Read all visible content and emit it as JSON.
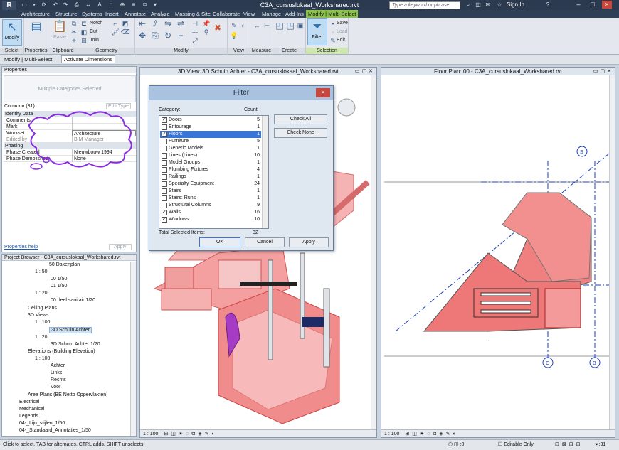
{
  "window": {
    "title": "C3A_cursuslokaal_Workshared.rvt",
    "search_placeholder": "Type a keyword or phrase",
    "signin": "Sign In"
  },
  "ribbon_tabs": [
    "Architecture",
    "Structure",
    "Systems",
    "Insert",
    "Annotate",
    "Analyze",
    "Massing & Site",
    "Collaborate",
    "View",
    "Manage",
    "Add-Ins",
    "Modify | Multi-Select"
  ],
  "ribbon": {
    "modify": "Modify",
    "select_label": "Select",
    "properties_label": "Properties",
    "clipboard": {
      "label": "Clipboard",
      "paste": "Paste"
    },
    "geometry": {
      "label": "Geometry",
      "notch": "Notch",
      "cut": "Cut",
      "join": "Join"
    },
    "modify_group": "Modify",
    "view_group": "View",
    "measure_group": "Measure",
    "create_group": "Create",
    "selection": {
      "label": "Selection",
      "filter": "Filter",
      "save": "Save",
      "load": "Load",
      "edit": "Edit"
    }
  },
  "context_bar": {
    "tab1": "Modify | Multi-Select",
    "tab2": "Activate Dimensions"
  },
  "properties": {
    "title": "Properties",
    "type_selector": "Multiple Categories Selected",
    "filter_count": "Common (31)",
    "edit_type": "Edit Type",
    "sections": {
      "identity": "Identity Data",
      "phasing": "Phasing"
    },
    "rows": [
      {
        "key": "Comments",
        "value": ""
      },
      {
        "key": "Mark",
        "value": ""
      },
      {
        "key": "Workset",
        "value": "Architecture"
      },
      {
        "key": "Edited by",
        "value": "BIM Manager"
      },
      {
        "key": "Phase Created",
        "value": "Nieuwbouw 1994"
      },
      {
        "key": "Phase Demolished",
        "value": "None"
      }
    ],
    "help": "Properties help",
    "apply": "Apply"
  },
  "browser": {
    "title": "Project Browser - C3A_cursuslokaal_Workshared.rvt",
    "items": [
      "50 Dakenplan",
      "1 : 50",
      "00 1/50",
      "01 1/50",
      "1 : 20",
      "00 deel sanitair 1/20",
      "Ceiling Plans",
      "3D Views",
      "1 : 100",
      "3D Schuin Achter",
      "1 : 20",
      "3D Schuin Achter 1/20",
      "Elevations (Building Elevation)",
      "1 : 100",
      "Achter",
      "Links",
      "Rechts",
      "Voor",
      "Area Plans (BE Netto Oppervlakten)",
      "Electrical",
      "Mechanical",
      "Legends",
      "04-_Lijn_stijlen_1/50",
      "04-_Standaard_Annotaties_1/50"
    ]
  },
  "view3d": {
    "title": "3D View: 3D Schuin Achter - C3A_cursuslokaal_Workshared.rvt",
    "scale": "1 : 100"
  },
  "plan": {
    "title": "Floor Plan: 00 - C3A_cursuslokaal_Workshared.rvt",
    "scale": "1 : 100",
    "grids": [
      "S",
      "C",
      "B"
    ]
  },
  "filter_dialog": {
    "title": "Filter",
    "category_label": "Category:",
    "count_label": "Count:",
    "categories": [
      {
        "name": "Doors",
        "count": "5",
        "checked": true,
        "selected": false
      },
      {
        "name": "Entourage",
        "count": "1",
        "checked": false,
        "selected": false
      },
      {
        "name": "Floors",
        "count": "1",
        "checked": true,
        "selected": true
      },
      {
        "name": "Furniture",
        "count": "5",
        "checked": false,
        "selected": false
      },
      {
        "name": "Generic Models",
        "count": "1",
        "checked": false,
        "selected": false
      },
      {
        "name": "Lines (Lines)",
        "count": "10",
        "checked": false,
        "selected": false
      },
      {
        "name": "Model Groups",
        "count": "1",
        "checked": false,
        "selected": false
      },
      {
        "name": "Plumbing Fixtures",
        "count": "4",
        "checked": false,
        "selected": false
      },
      {
        "name": "Railings",
        "count": "1",
        "checked": false,
        "selected": false
      },
      {
        "name": "Specialty Equipment",
        "count": "24",
        "checked": false,
        "selected": false
      },
      {
        "name": "Stairs",
        "count": "1",
        "checked": false,
        "selected": false
      },
      {
        "name": "Stairs: Runs",
        "count": "1",
        "checked": false,
        "selected": false
      },
      {
        "name": "Structural Columns",
        "count": "9",
        "checked": false,
        "selected": false
      },
      {
        "name": "Walls",
        "count": "16",
        "checked": true,
        "selected": false
      },
      {
        "name": "Windows",
        "count": "10",
        "checked": true,
        "selected": false
      }
    ],
    "check_all": "Check All",
    "check_none": "Check None",
    "total_label": "Total Selected Items:",
    "total": "32",
    "ok": "OK",
    "cancel": "Cancel",
    "apply": "Apply"
  },
  "status": {
    "text": "Click to select, TAB for alternates, CTRL adds, SHIFT unselects.",
    "editable": "Editable Only",
    "count": ":31"
  },
  "colors": {
    "accent": "#8bc34a",
    "selection": "#3875d7",
    "model_red": "#f08080",
    "cloud": "#8a2be2"
  }
}
